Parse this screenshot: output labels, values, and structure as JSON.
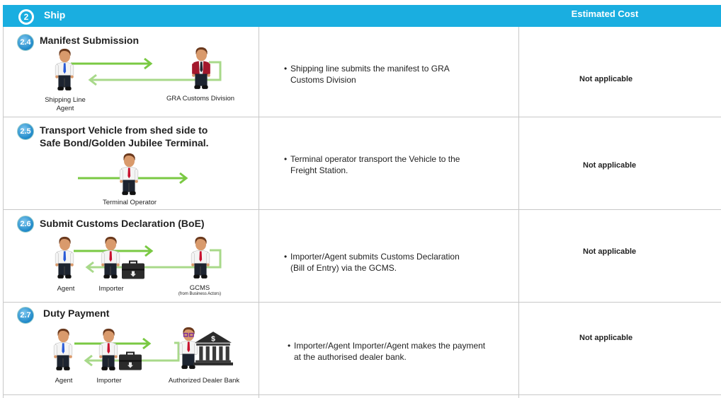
{
  "header": {
    "step_number": "2",
    "title": "Ship",
    "cost_header": "Estimated Cost"
  },
  "colors": {
    "header_bg": "#1aaee0",
    "arrow_green": "#7ac943",
    "grid": "#c8c8c8"
  },
  "rows": [
    {
      "number": "2.4",
      "title_lines": [
        "Manifest Submission"
      ],
      "actors": [
        "Shipping Line Agent",
        "GRA Customs Division"
      ],
      "description_lines": [
        "Shipping line submits the manifest to GRA",
        "Customs Division"
      ],
      "cost": "Not applicable"
    },
    {
      "number": "2.5",
      "title_lines": [
        "Transport Vehicle from shed side to",
        "Safe Bond/Golden Jubilee Terminal."
      ],
      "actors": [
        "Terminal Operator"
      ],
      "description_lines": [
        "Terminal operator transport the Vehicle to the",
        "Freight Station."
      ],
      "cost": "Not applicable"
    },
    {
      "number": "2.6",
      "title_lines": [
        "Submit Customs Declaration (BoE)"
      ],
      "actors": [
        "Agent",
        "Importer",
        "GCMS"
      ],
      "actor_note": "(from Business Actors)",
      "description_lines": [
        "Importer/Agent submits Customs Declaration",
        "(Bill of Entry) via the GCMS."
      ],
      "cost": "Not applicable"
    },
    {
      "number": "2.7",
      "title_lines": [
        "Duty Payment"
      ],
      "actors": [
        "Agent",
        "Importer",
        "Authorized Dealer Bank"
      ],
      "description_lines": [
        "Importer/Agent Importer/Agent makes the payment",
        "at the authorised dealer bank."
      ],
      "cost": "Not applicable"
    }
  ]
}
